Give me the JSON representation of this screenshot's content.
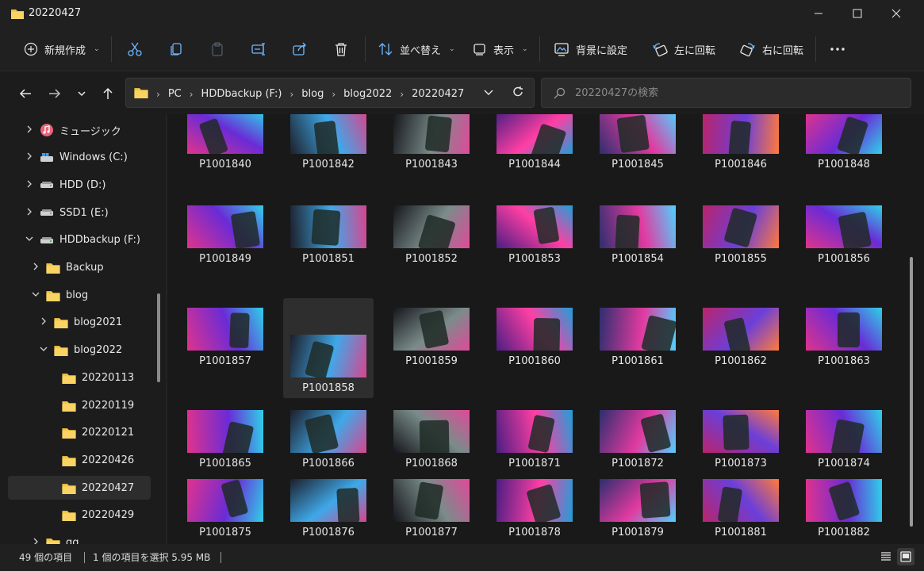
{
  "window": {
    "title": "20220427"
  },
  "toolbar": {
    "new_label": "新規作成",
    "sort_label": "並べ替え",
    "view_label": "表示",
    "set_background_label": "背景に設定",
    "rotate_left_label": "左に回転",
    "rotate_right_label": "右に回転"
  },
  "address": {
    "crumbs": [
      "PC",
      "HDDbackup (F:)",
      "blog",
      "blog2022",
      "20220427"
    ]
  },
  "search": {
    "placeholder": "20220427の検索"
  },
  "sidebar": {
    "items": [
      {
        "label": "ミュージック",
        "icon": "music-icon",
        "level": 1,
        "arrow": "right"
      },
      {
        "label": "Windows (C:)",
        "icon": "windows-drive-icon",
        "level": 1,
        "arrow": "right"
      },
      {
        "label": "HDD (D:)",
        "icon": "drive-icon",
        "level": 1,
        "arrow": "right"
      },
      {
        "label": "SSD1 (E:)",
        "icon": "drive-icon",
        "level": 1,
        "arrow": "right"
      },
      {
        "label": "HDDbackup (F:)",
        "icon": "drive-icon",
        "level": 1,
        "arrow": "down"
      },
      {
        "label": "Backup",
        "icon": "folder-icon",
        "level": 2,
        "arrow": "right"
      },
      {
        "label": "blog",
        "icon": "folder-icon",
        "level": 2,
        "arrow": "down"
      },
      {
        "label": "blog2021",
        "icon": "folder-icon",
        "level": 3,
        "arrow": "right"
      },
      {
        "label": "blog2022",
        "icon": "folder-icon",
        "level": 3,
        "arrow": "down"
      },
      {
        "label": "20220113",
        "icon": "folder-icon",
        "level": 4,
        "arrow": "none"
      },
      {
        "label": "20220119",
        "icon": "folder-icon",
        "level": 4,
        "arrow": "none"
      },
      {
        "label": "20220121",
        "icon": "folder-icon",
        "level": 4,
        "arrow": "none"
      },
      {
        "label": "20220426",
        "icon": "folder-icon",
        "level": 4,
        "arrow": "none"
      },
      {
        "label": "20220427",
        "icon": "folder-icon",
        "level": 4,
        "arrow": "none",
        "selected": true
      },
      {
        "label": "20220429",
        "icon": "folder-icon",
        "level": 4,
        "arrow": "none"
      },
      {
        "label": "gg",
        "icon": "folder-icon",
        "level": 2,
        "arrow": "right"
      }
    ]
  },
  "files": [
    "P1001840",
    "P1001842",
    "P1001843",
    "P1001844",
    "P1001845",
    "P1001846",
    "P1001848",
    "P1001849",
    "P1001851",
    "P1001852",
    "P1001853",
    "P1001854",
    "P1001855",
    "P1001856",
    "P1001857",
    "P1001858",
    "P1001859",
    "P1001860",
    "P1001861",
    "P1001862",
    "P1001863",
    "P1001865",
    "P1001866",
    "P1001868",
    "P1001871",
    "P1001872",
    "P1001873",
    "P1001874",
    "P1001875",
    "P1001876",
    "P1001877",
    "P1001878",
    "P1001879",
    "P1001881",
    "P1001882"
  ],
  "selected_file": "P1001858",
  "status": {
    "item_count": "49 個の項目",
    "selection": "1 個の項目を選択  5.95 MB"
  }
}
